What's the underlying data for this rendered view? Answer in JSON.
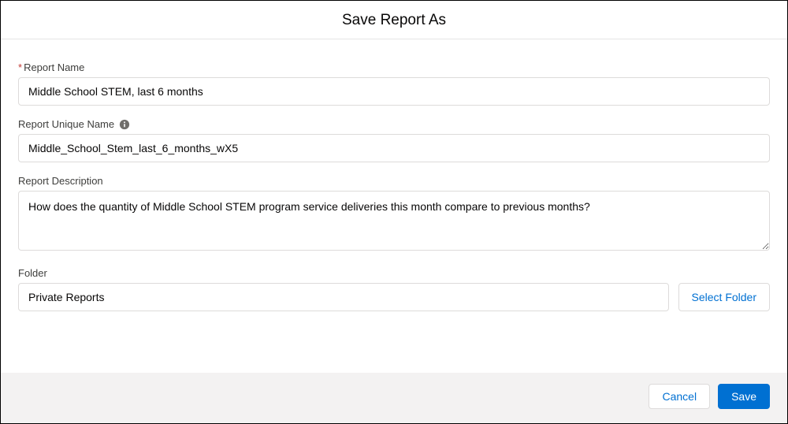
{
  "header": {
    "title": "Save Report As"
  },
  "form": {
    "reportName": {
      "label": "Report Name",
      "required": true,
      "value": "Middle School STEM, last 6 months"
    },
    "reportUniqueName": {
      "label": "Report Unique Name",
      "value": "Middle_School_Stem_last_6_months_wX5"
    },
    "reportDescription": {
      "label": "Report Description",
      "value": "How does the quantity of Middle School STEM program service deliveries this month compare to previous months?"
    },
    "folder": {
      "label": "Folder",
      "value": "Private Reports",
      "selectButton": "Select Folder"
    }
  },
  "footer": {
    "cancel": "Cancel",
    "save": "Save"
  }
}
